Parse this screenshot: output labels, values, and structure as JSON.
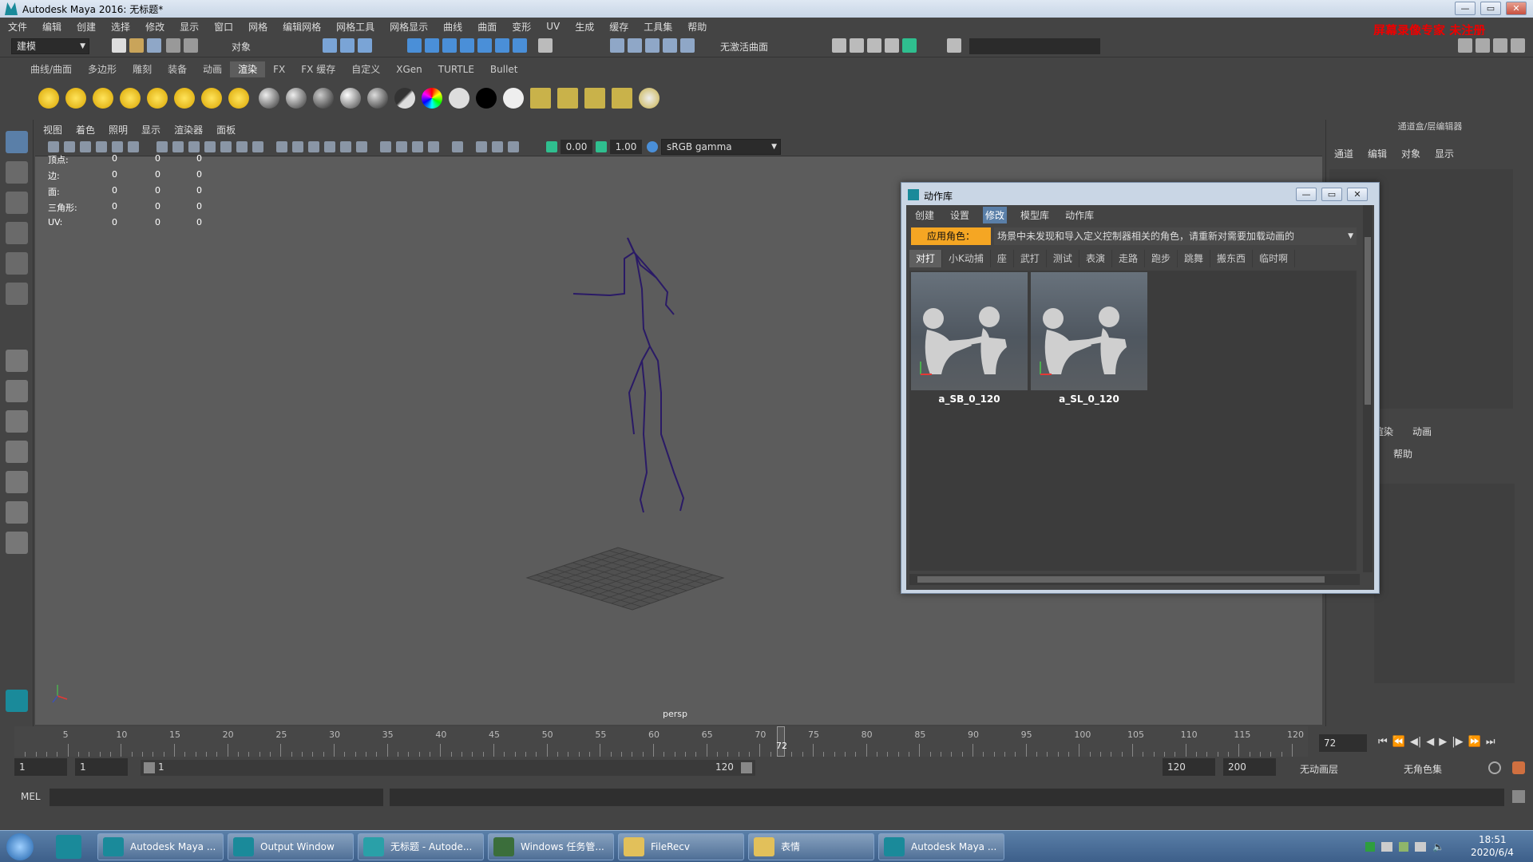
{
  "window": {
    "title": "Autodesk Maya 2016: 无标题*",
    "min": "—",
    "max": "▭",
    "close": "✕"
  },
  "menubar": [
    "文件",
    "编辑",
    "创建",
    "选择",
    "修改",
    "显示",
    "窗口",
    "网格",
    "编辑网格",
    "网格工具",
    "网格显示",
    "曲线",
    "曲面",
    "变形",
    "UV",
    "生成",
    "缓存",
    "工具集",
    "帮助"
  ],
  "watermark": "屏幕录像专家 未注册",
  "toolbar": {
    "mode": "建模",
    "object_label": "对象",
    "live_surface": "无激活曲面"
  },
  "shelf_tabs": [
    "曲线/曲面",
    "多边形",
    "雕刻",
    "装备",
    "动画",
    "渲染",
    "FX",
    "FX 缓存",
    "自定义",
    "XGen",
    "TURTLE",
    "Bullet"
  ],
  "shelf_active": "渲染",
  "viewport": {
    "menu": [
      "视图",
      "着色",
      "照明",
      "显示",
      "渲染器",
      "面板"
    ],
    "exposure": "0.00",
    "gamma": "1.00",
    "color_space": "sRGB gamma",
    "camera": "persp",
    "hud": [
      {
        "label": "顶点:",
        "v1": "0",
        "v2": "0",
        "v3": "0"
      },
      {
        "label": "边:",
        "v1": "0",
        "v2": "0",
        "v3": "0"
      },
      {
        "label": "面:",
        "v1": "0",
        "v2": "0",
        "v3": "0"
      },
      {
        "label": "三角形:",
        "v1": "0",
        "v2": "0",
        "v3": "0"
      },
      {
        "label": "UV:",
        "v1": "0",
        "v2": "0",
        "v3": "0"
      }
    ]
  },
  "right_panel": {
    "title": "通道盒/层编辑器",
    "menu": [
      "通道",
      "编辑",
      "对象",
      "显示"
    ],
    "layer_tabs": [
      "渲染",
      "动画"
    ],
    "help": "帮助"
  },
  "dialog": {
    "title": "动作库",
    "menu": [
      "创建",
      "设置",
      "修改",
      "模型库",
      "动作库"
    ],
    "menu_selected": "修改",
    "apply_label": "应用角色：",
    "role_text": "场景中未发现和导入定义控制器相关的角色，请重新对需要加载动画的",
    "tabs": [
      "对打",
      "小K动捕",
      "座",
      "武打",
      "测试",
      "表演",
      "走路",
      "跑步",
      "跳舞",
      "搬东西",
      "临时啊"
    ],
    "active_tab": "对打",
    "items": [
      {
        "name": "a_SB_0_120"
      },
      {
        "name": "a_SL_0_120"
      }
    ]
  },
  "timeline": {
    "ticks": [
      "5",
      "10",
      "15",
      "20",
      "25",
      "30",
      "35",
      "40",
      "45",
      "50",
      "55",
      "60",
      "65",
      "70",
      "75",
      "80",
      "85",
      "90",
      "95",
      "100",
      "105",
      "110",
      "115",
      "120"
    ],
    "current": "72",
    "current_field": "72"
  },
  "range": {
    "start": "1",
    "start2": "1",
    "slider_start": "1",
    "slider_end": "120",
    "end": "120",
    "end2": "200",
    "anim_layer": "无动画层",
    "char_set": "无角色集"
  },
  "mel": {
    "label": "MEL"
  },
  "taskbar": {
    "items": [
      "Autodesk Maya ...",
      "Output Window",
      "无标题 - Autode...",
      "Windows 任务管...",
      "FileRecv",
      "表情",
      "Autodesk Maya ..."
    ],
    "time": "18:51",
    "date": "2020/6/4"
  },
  "colors": {
    "accent": "#f5a623",
    "selected_menu": "#5a7fa8",
    "skeleton": "#2a1a66"
  }
}
